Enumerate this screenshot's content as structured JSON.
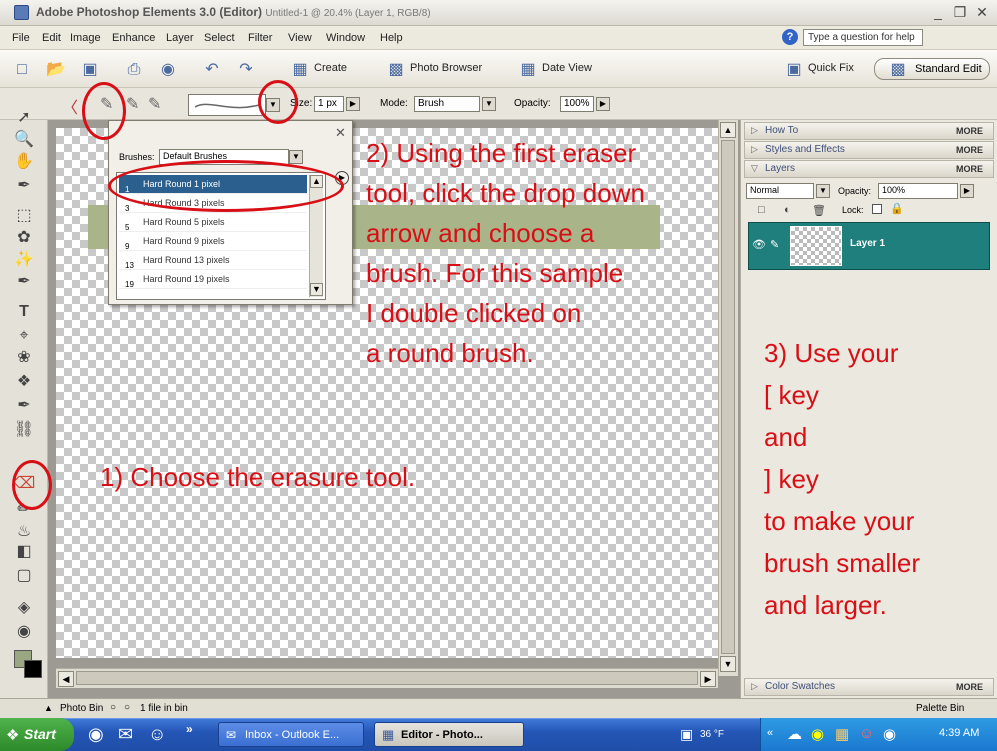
{
  "window": {
    "title": "Adobe Photoshop Elements 3.0 (Editor)",
    "document": "Untitled-1 @ 20.4% (Layer 1, RGB/8)",
    "controls": [
      "_",
      "❐",
      "✕"
    ]
  },
  "menu": {
    "items": [
      "File",
      "Edit",
      "Image",
      "Enhance",
      "Layer",
      "Select",
      "Filter",
      "View",
      "Window",
      "Help"
    ],
    "help_placeholder": "Type a question for help"
  },
  "shortcuts": {
    "create": "Create",
    "photo_browser": "Photo Browser",
    "date_view": "Date View",
    "quick_fix": "Quick Fix",
    "standard_edit": "Standard Edit"
  },
  "options": {
    "size_label": "Size:",
    "size_value": "1 px",
    "mode_label": "Mode:",
    "mode_value": "Brush",
    "opacity_label": "Opacity:",
    "opacity_value": "100%"
  },
  "brush_picker": {
    "label": "Brushes:",
    "set_value": "Default Brushes",
    "items": [
      {
        "size": "1",
        "name": "Hard Round 1 pixel"
      },
      {
        "size": "3",
        "name": "Hard Round 3 pixels"
      },
      {
        "size": "5",
        "name": "Hard Round 5 pixels"
      },
      {
        "size": "9",
        "name": "Hard Round 9 pixels"
      },
      {
        "size": "13",
        "name": "Hard Round 13 pixels"
      },
      {
        "size": "19",
        "name": "Hard Round 19 pixels"
      }
    ],
    "close": "✕"
  },
  "palettes": {
    "how_to": "How To",
    "styles": "Styles and Effects",
    "layers": "Layers",
    "color_swatches": "Color Swatches",
    "more": "MORE",
    "blend_mode": "Normal",
    "opacity_label": "Opacity:",
    "opacity_value": "100%",
    "lock_label": "Lock:",
    "layer_name": "Layer 1"
  },
  "bin": {
    "photo_bin": "Photo Bin",
    "files": "1 file in bin",
    "palette_bin": "Palette Bin"
  },
  "taskbar": {
    "start": "Start",
    "tasks": [
      "Inbox - Outlook E...",
      "Editor - Photo..."
    ],
    "temp": "36 °F",
    "clock": "4:39 AM"
  },
  "annotations": {
    "step2": [
      "2) Using the first eraser",
      "tool, click the drop down",
      "arrow and choose a",
      "brush.  For this sample",
      "I double clicked on",
      "a round brush."
    ],
    "step1": "1)  Choose the erasure tool.",
    "step3": [
      "3)  Use your",
      "[ key",
      "and",
      "] key",
      "to make your",
      "brush smaller",
      "and larger."
    ]
  },
  "colors": {
    "annotation": "#d80f16",
    "layer_highlight": "#1e7f7d",
    "canvas_band": "#a9b589"
  }
}
